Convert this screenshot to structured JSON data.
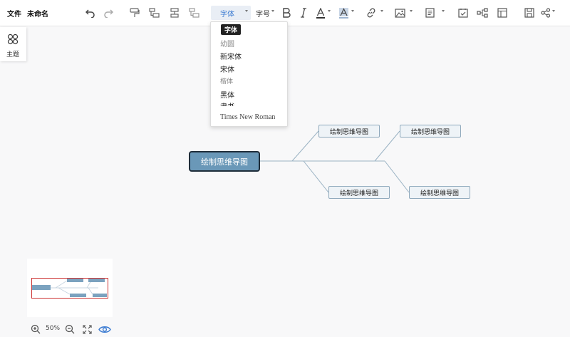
{
  "menu": {
    "file": "文件",
    "doc_title": "未命名"
  },
  "toolbar": {
    "font_label": "字体",
    "font_size_label": "字号",
    "buttons": [
      "undo",
      "redo",
      "format-painter",
      "insert-child",
      "insert-sibling",
      "insert-parent",
      "bold",
      "italic",
      "font-color",
      "highlight",
      "link",
      "image",
      "note",
      "task",
      "structure",
      "layout",
      "save",
      "share"
    ]
  },
  "font_dropdown": {
    "tooltip": "字体",
    "options": [
      "幼圆",
      "新宋体",
      "宋体",
      "楷体",
      "黑体",
      "隶书",
      "Times New Roman"
    ]
  },
  "side_panel": {
    "theme_label": "主题"
  },
  "mindmap": {
    "root": "绘制思维导图",
    "children": [
      "绘制思维导图",
      "绘制思维导图",
      "绘制思维导图",
      "绘制思维导图"
    ]
  },
  "zoom": {
    "value": "50%"
  },
  "colors": {
    "root_fill": "#6a98b8",
    "accent": "#3b7bd2",
    "minimap_frame": "#cc3333"
  }
}
